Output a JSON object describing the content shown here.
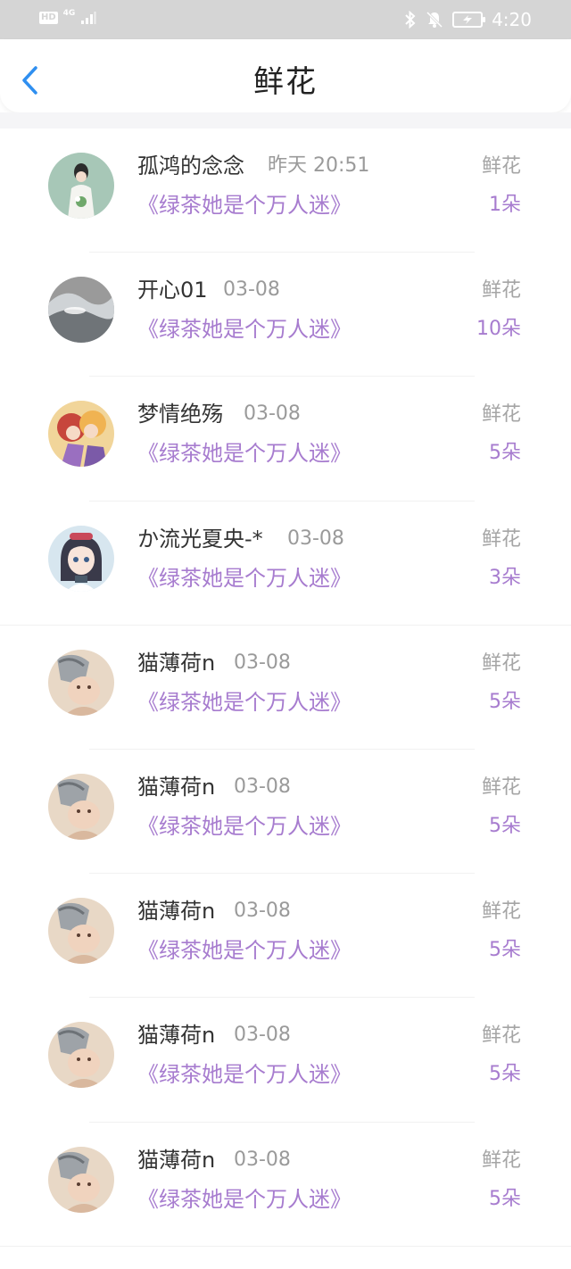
{
  "status_bar": {
    "hd": "HD",
    "network": "4G",
    "time": "4:20"
  },
  "header": {
    "title": "鲜花"
  },
  "colors": {
    "accent": "#a77ccf",
    "back": "#2f8ff0"
  },
  "rows": [
    {
      "name": "孤鸿的念念",
      "date": "昨天 20:51",
      "book": "《绿茶她是个万人迷》",
      "gift": "鲜花",
      "count": "1朵",
      "avatar": "girl-avatar-green"
    },
    {
      "name": "开心01",
      "date": "03-08",
      "book": "《绿茶她是个万人迷》",
      "gift": "鲜花",
      "count": "10朵",
      "avatar": "water-avatar"
    },
    {
      "name": "梦情绝殇",
      "date": "03-08",
      "book": "《绿茶她是个万人迷》",
      "gift": "鲜花",
      "count": "5朵",
      "avatar": "anime-couple-avatar"
    },
    {
      "name": "か流光夏央-*",
      "date": "03-08",
      "book": "《绿茶她是个万人迷》",
      "gift": "鲜花",
      "count": "3朵",
      "avatar": "anime-girl-avatar"
    },
    {
      "name": "猫薄荷n",
      "date": "03-08",
      "book": "《绿茶她是个万人迷》",
      "gift": "鲜花",
      "count": "5朵",
      "avatar": "cat-avatar"
    },
    {
      "name": "猫薄荷n",
      "date": "03-08",
      "book": "《绿茶她是个万人迷》",
      "gift": "鲜花",
      "count": "5朵",
      "avatar": "cat-avatar"
    },
    {
      "name": "猫薄荷n",
      "date": "03-08",
      "book": "《绿茶她是个万人迷》",
      "gift": "鲜花",
      "count": "5朵",
      "avatar": "cat-avatar"
    },
    {
      "name": "猫薄荷n",
      "date": "03-08",
      "book": "《绿茶她是个万人迷》",
      "gift": "鲜花",
      "count": "5朵",
      "avatar": "cat-avatar"
    },
    {
      "name": "猫薄荷n",
      "date": "03-08",
      "book": "《绿茶她是个万人迷》",
      "gift": "鲜花",
      "count": "5朵",
      "avatar": "cat-avatar"
    }
  ]
}
